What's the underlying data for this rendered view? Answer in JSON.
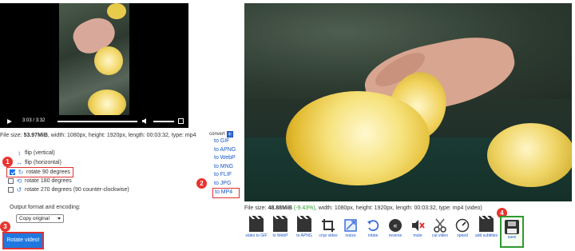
{
  "left": {
    "video": {
      "time_current": "3:03",
      "time_total": "3:32"
    },
    "file_info": {
      "prefix": "File size: ",
      "size": "53.97MiB",
      "rest": ", width: 1080px, height: 1920px, length: 00:03:32, type: mp4"
    },
    "options": [
      {
        "label": "flip (vertical)",
        "checked": false,
        "has_checkbox": false,
        "icon": "flip-vertical-icon",
        "glyph": "↕"
      },
      {
        "label": "flip (horizontal)",
        "checked": false,
        "has_checkbox": false,
        "icon": "flip-horizontal-icon",
        "glyph": "↔"
      },
      {
        "label": "rotate 90 degrees",
        "checked": true,
        "has_checkbox": true,
        "icon": "rotate-90-icon",
        "glyph": "↻"
      },
      {
        "label": "rotate 180 degrees",
        "checked": false,
        "has_checkbox": true,
        "icon": "rotate-180-icon",
        "glyph": "⟲"
      },
      {
        "label": "rotate 270 degrees (90 counter-clockwise)",
        "checked": false,
        "has_checkbox": true,
        "icon": "rotate-270-icon",
        "glyph": "↺"
      }
    ],
    "format_label": "Output format and encoding:",
    "format_select_value": "Copy original",
    "rotate_button": "Rotate video!"
  },
  "convert": {
    "header": "convert",
    "plus_glyph": "+",
    "links": [
      "to GIF",
      "to APNG",
      "to WebP",
      "to MNG",
      "to FLIF",
      "to JPG",
      "to MP4"
    ]
  },
  "badges": [
    "1",
    "2",
    "3",
    "4"
  ],
  "right": {
    "file_info": {
      "prefix": "File size: ",
      "size": "48.88MiB",
      "pct": "(-9.43%)",
      "rest": ", width: 1080px, height: 1920px, length: 00:03:32, type: mp4 (video)"
    },
    "toolbar": [
      {
        "label": "video to GIF",
        "icon": "clapperboard-icon"
      },
      {
        "label": "to WebP",
        "icon": "clapperboard-icon"
      },
      {
        "label": "to APNG",
        "icon": "clapperboard-icon"
      },
      {
        "label": "crop video",
        "icon": "crop-icon"
      },
      {
        "label": "resize",
        "icon": "resize-icon"
      },
      {
        "label": "rotate",
        "icon": "rotate-icon"
      },
      {
        "label": "reverse",
        "icon": "reverse-icon"
      },
      {
        "label": "mute",
        "icon": "mute-icon"
      },
      {
        "label": "cut video",
        "icon": "scissors-icon"
      },
      {
        "label": "speed",
        "icon": "speed-icon"
      },
      {
        "label": "add subtitles",
        "icon": "subtitles-icon"
      },
      {
        "label": "save",
        "icon": "save-icon"
      }
    ]
  },
  "colors": {
    "accent": "#1f78e0",
    "highlight_red": "#e03131",
    "save_green": "#2e9a2e",
    "link_blue": "#1a58c9"
  }
}
